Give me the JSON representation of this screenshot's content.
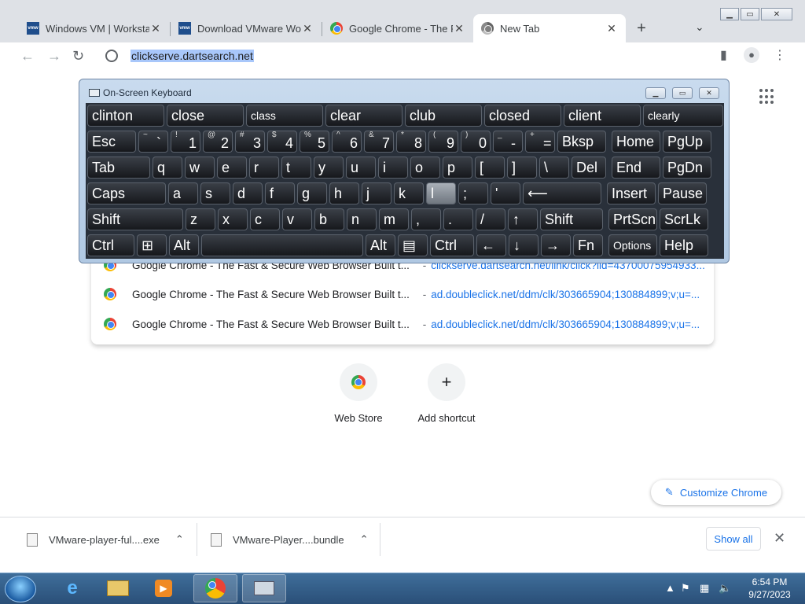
{
  "tabs": [
    {
      "title": "Windows VM | Workstat",
      "icon": "vmware-icon"
    },
    {
      "title": "Download VMware Wor",
      "icon": "vmware-icon"
    },
    {
      "title": "Google Chrome - The Fa",
      "icon": "chrome-icon"
    },
    {
      "title": "New Tab",
      "icon": "chrome-icon"
    }
  ],
  "toolbar": {
    "url": "clickserve.dartsearch.net"
  },
  "suggestions": [
    {
      "title": "Google Chrome - The Fast & Secure Web Browser Built t...",
      "url": "clickserve.dartsearch.net/link/click?lid=43700075954933..."
    },
    {
      "title": "Google Chrome - The Fast & Secure Web Browser Built t...",
      "url": "ad.doubleclick.net/ddm/clk/303665904;130884899;v;u=..."
    },
    {
      "title": "Google Chrome - The Fast & Secure Web Browser Built t...",
      "url": "ad.doubleclick.net/ddm/clk/303665904;130884899;v;u=..."
    }
  ],
  "shortcuts": [
    {
      "label": "Web Store",
      "icon": "webstore-icon"
    },
    {
      "label": "Add shortcut",
      "glyph": "+"
    }
  ],
  "customize_label": "Customize Chrome",
  "downloads": [
    {
      "name": "VMware-player-ful....exe"
    },
    {
      "name": "VMware-Player....bundle"
    }
  ],
  "show_all": "Show all",
  "osk": {
    "title": "On-Screen Keyboard",
    "predictions": [
      "clinton",
      "close",
      "class",
      "clear",
      "club",
      "closed",
      "client",
      "clearly"
    ],
    "row1": [
      {
        "label": "Esc"
      },
      {
        "label": "`",
        "shift": "~"
      },
      {
        "label": "1",
        "shift": "!"
      },
      {
        "label": "2",
        "shift": "@"
      },
      {
        "label": "3",
        "shift": "#"
      },
      {
        "label": "4",
        "shift": "$"
      },
      {
        "label": "5",
        "shift": "%"
      },
      {
        "label": "6",
        "shift": "^"
      },
      {
        "label": "7",
        "shift": "&"
      },
      {
        "label": "8",
        "shift": "*"
      },
      {
        "label": "9",
        "shift": "("
      },
      {
        "label": "0",
        "shift": ")"
      },
      {
        "label": "-",
        "shift": "_"
      },
      {
        "label": "=",
        "shift": "+"
      },
      {
        "label": "Bksp"
      },
      {
        "label": "Home"
      },
      {
        "label": "PgUp"
      }
    ],
    "row2": [
      "Tab",
      "q",
      "w",
      "e",
      "r",
      "t",
      "y",
      "u",
      "i",
      "o",
      "p",
      "[",
      "]",
      "\\",
      "Del",
      "End",
      "PgDn"
    ],
    "row3": [
      "Caps",
      "a",
      "s",
      "d",
      "f",
      "g",
      "h",
      "j",
      "k",
      "l",
      ";",
      "'",
      "⟵",
      "Insert",
      "Pause"
    ],
    "row4": [
      "Shift",
      "z",
      "x",
      "c",
      "v",
      "b",
      "n",
      "m",
      ",",
      ".",
      "/",
      "↑",
      "Shift",
      "PrtScn",
      "ScrLk"
    ],
    "row5": [
      "Ctrl",
      "⊞",
      "Alt",
      "",
      "Alt",
      "▤",
      "Ctrl",
      "←",
      "↓",
      "→",
      "Fn",
      "Options",
      "Help"
    ]
  },
  "tray": {
    "time": "6:54 PM",
    "date": "9/27/2023"
  }
}
